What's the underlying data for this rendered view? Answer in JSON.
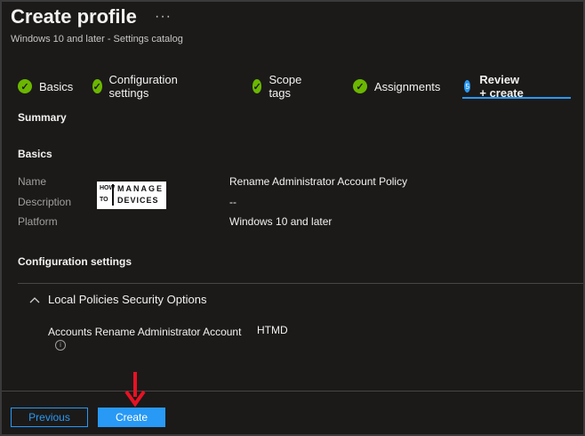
{
  "header": {
    "title": "Create profile",
    "more": "···",
    "subtitle": "Windows 10 and later - Settings catalog"
  },
  "wizard": {
    "steps": [
      {
        "label": "Basics",
        "state": "complete"
      },
      {
        "label": "Configuration settings",
        "state": "complete"
      },
      {
        "label": "Scope tags",
        "state": "complete"
      },
      {
        "label": "Assignments",
        "state": "complete"
      },
      {
        "label": "Review + create",
        "state": "active",
        "number": "5"
      }
    ]
  },
  "summary": {
    "heading": "Summary",
    "basics_heading": "Basics",
    "basics": [
      {
        "label": "Name",
        "value": "Rename Administrator Account Policy"
      },
      {
        "label": "Description",
        "value": "--"
      },
      {
        "label": "Platform",
        "value": "Windows 10 and later"
      }
    ],
    "config_heading": "Configuration settings",
    "group": {
      "title": "Local Policies Security Options",
      "setting_name": "Accounts Rename Administrator Account",
      "setting_value": "HTMD"
    }
  },
  "logo": {
    "how": "HOW",
    "to": "TO",
    "manage": "MANAGE",
    "devices": "DEVICES"
  },
  "footer": {
    "previous_label": "Previous",
    "create_label": "Create"
  },
  "colors": {
    "accent": "#2899f5",
    "success": "#6bb700",
    "arrow": "#e81123",
    "background": "#1b1a19"
  }
}
